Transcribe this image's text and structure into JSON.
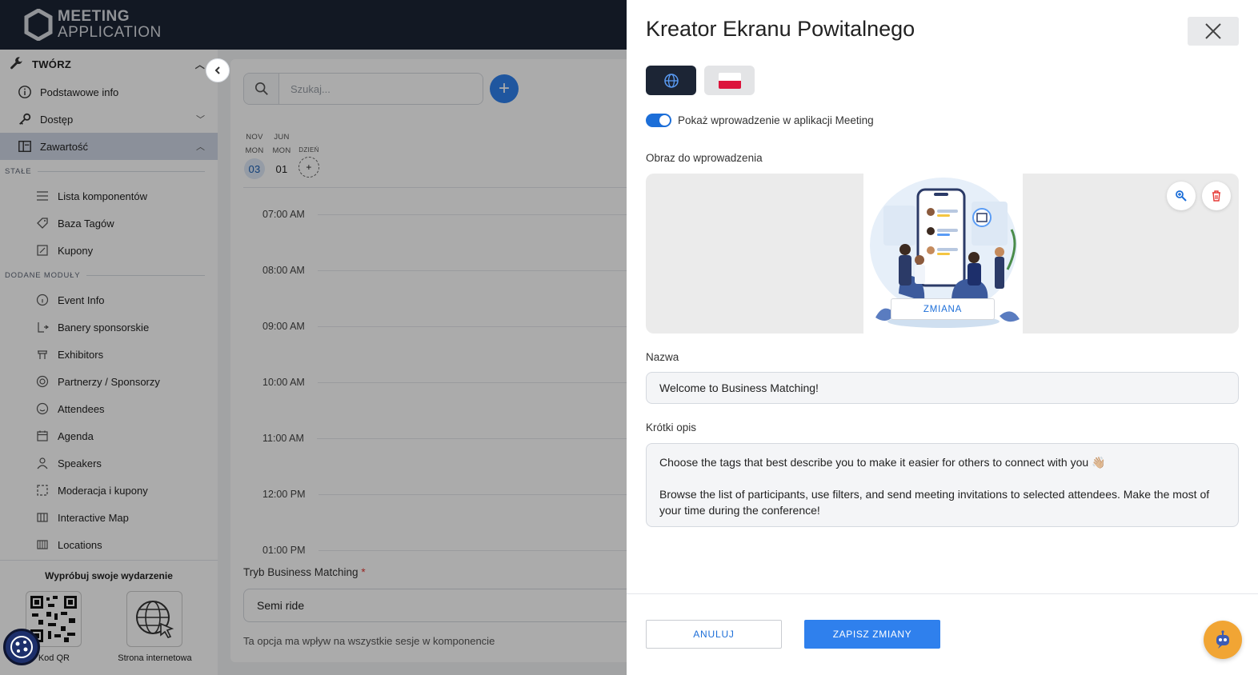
{
  "app": {
    "logo_line1": "MEETING",
    "logo_line2": "APPLICATION"
  },
  "sidebar": {
    "group_title": "TWÓRZ",
    "items": [
      {
        "label": "Podstawowe info",
        "icon": "info-icon"
      },
      {
        "label": "Dostęp",
        "icon": "key-icon"
      },
      {
        "label": "Zawartość",
        "icon": "layout-icon"
      }
    ],
    "section_fixed": "STAŁE",
    "fixed_items": [
      {
        "label": "Lista komponentów",
        "icon": "list-icon"
      },
      {
        "label": "Baza Tagów",
        "icon": "tag-icon"
      },
      {
        "label": "Kupony",
        "icon": "coupon-icon"
      }
    ],
    "section_added": "DODANE MODUŁY",
    "module_items": [
      {
        "label": "Event Info",
        "icon": "info-icon"
      },
      {
        "label": "Banery sponsorskie",
        "icon": "banner-icon"
      },
      {
        "label": "Exhibitors",
        "icon": "booth-icon"
      },
      {
        "label": "Partnerzy / Sponsorzy",
        "icon": "partners-icon"
      },
      {
        "label": "Attendees",
        "icon": "smile-icon"
      },
      {
        "label": "Agenda",
        "icon": "calendar-icon"
      },
      {
        "label": "Speakers",
        "icon": "user-icon"
      },
      {
        "label": "Moderacja i kupony",
        "icon": "moderation-icon"
      },
      {
        "label": "Interactive Map",
        "icon": "map-icon"
      },
      {
        "label": "Locations",
        "icon": "location-icon"
      }
    ],
    "try_title": "Wypróbuj swoje wydarzenie",
    "try_qr": "Kod QR",
    "try_web": "Strona internetowa"
  },
  "main": {
    "search_placeholder": "Szukaj...",
    "days": [
      {
        "month": "NOV",
        "weekday": "MON",
        "day": "03"
      },
      {
        "month": "JUN",
        "weekday": "MON",
        "day": "01"
      },
      {
        "month": "",
        "weekday": "DZIEŃ",
        "day": "+"
      }
    ],
    "times": [
      "07:00 AM",
      "08:00 AM",
      "09:00 AM",
      "10:00 AM",
      "11:00 AM",
      "12:00 PM",
      "01:00 PM"
    ],
    "bm_label": "Tryb Business Matching",
    "bm_required": "*",
    "bm_value": "Semi ride",
    "bm_hint": "Ta opcja ma wpływ na wszystkie sesje w komponencie"
  },
  "drawer": {
    "title": "Kreator Ekranu Powitalnego",
    "toggle_label": "Pokaż wprowadzenie w aplikacji Meeting",
    "toggle_on": true,
    "image_label": "Obraz do wprowadzenia",
    "image_change": "ZMIANA",
    "name_label": "Nazwa",
    "name_value": "Welcome to Business Matching!",
    "desc_label": "Krótki opis",
    "desc_line1": "Choose the tags that best describe you to make it easier for others to connect with you 👋🏼",
    "desc_line2": "Browse the list of participants, use filters, and send meeting invitations to selected attendees. Make the most of your time during the conference!",
    "cancel": "ANULUJ",
    "save": "ZAPISZ ZMIANY"
  },
  "colors": {
    "header_bg": "#1c2535",
    "accent": "#2f80ed",
    "chat": "#f1a534"
  }
}
